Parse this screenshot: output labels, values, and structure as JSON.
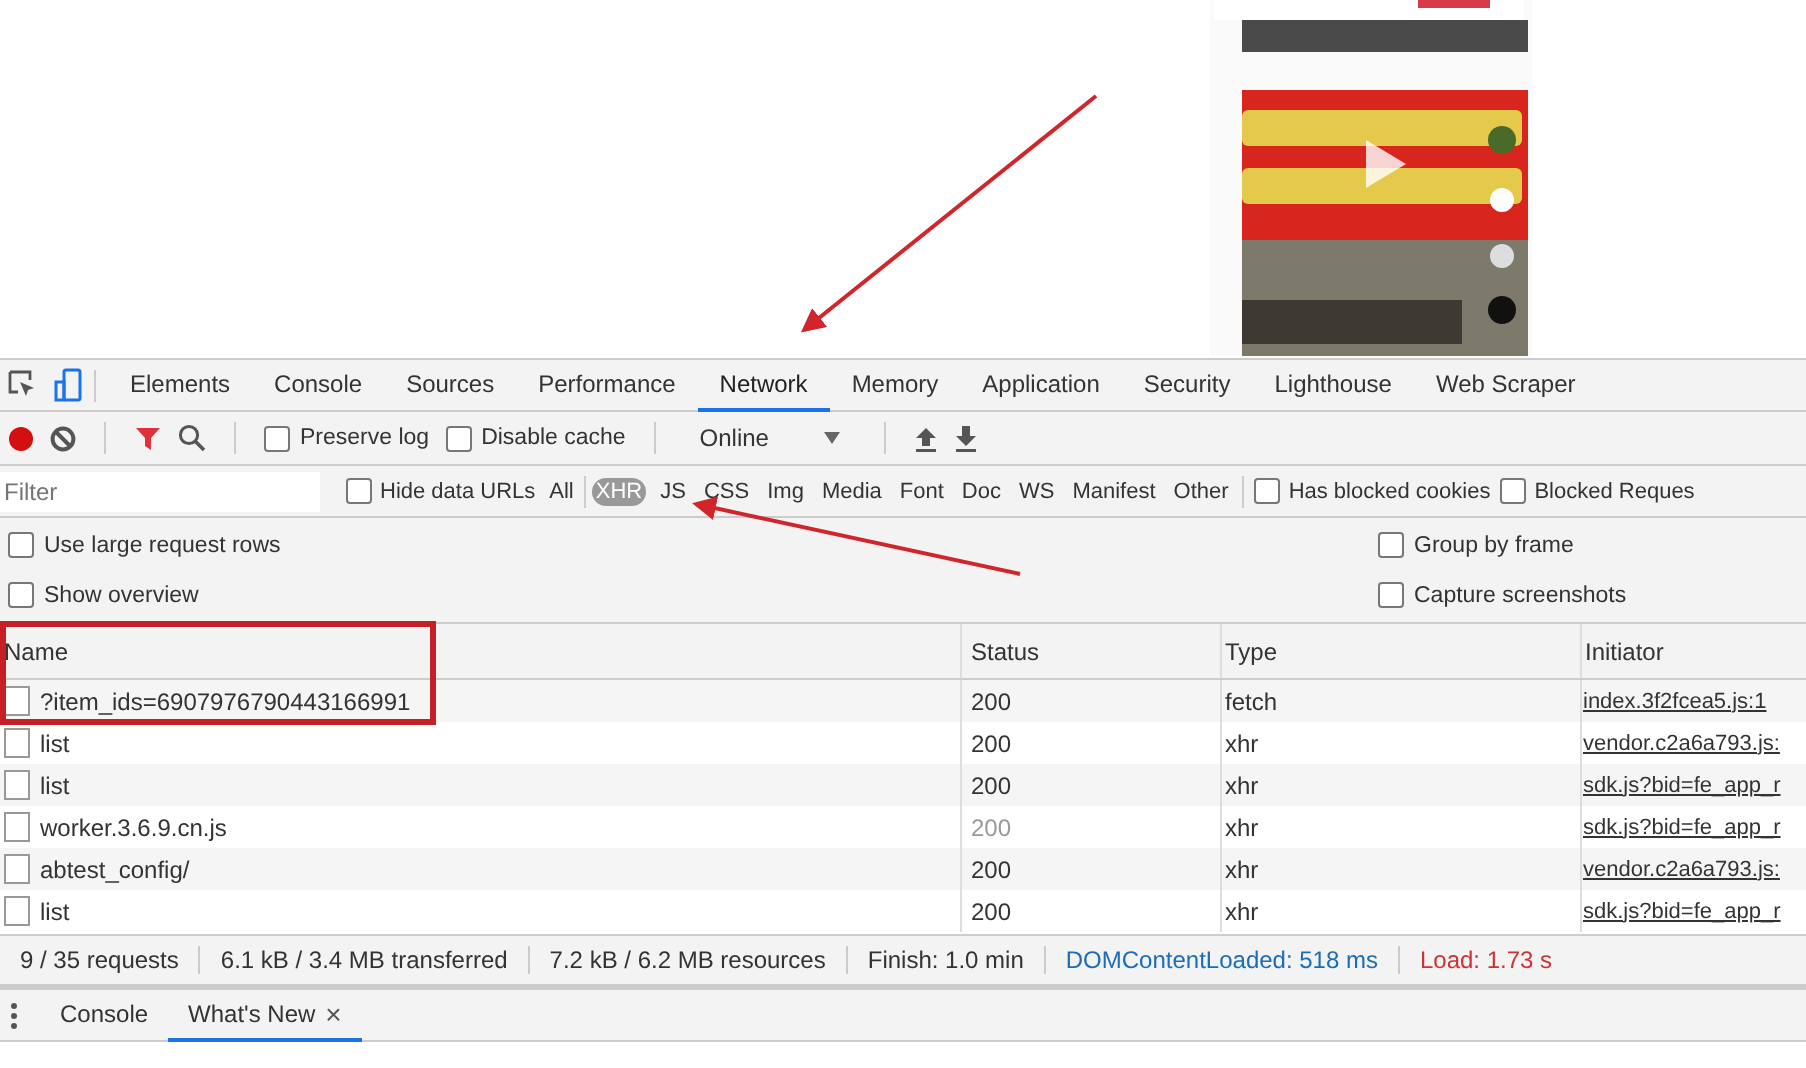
{
  "tabs": [
    {
      "label": "Elements",
      "selected": false
    },
    {
      "label": "Console",
      "selected": false
    },
    {
      "label": "Sources",
      "selected": false
    },
    {
      "label": "Performance",
      "selected": false
    },
    {
      "label": "Network",
      "selected": true
    },
    {
      "label": "Memory",
      "selected": false
    },
    {
      "label": "Application",
      "selected": false
    },
    {
      "label": "Security",
      "selected": false
    },
    {
      "label": "Lighthouse",
      "selected": false
    },
    {
      "label": "Web Scraper",
      "selected": false
    }
  ],
  "toolbar": {
    "recording": true,
    "filter_active": true,
    "preserve_log": {
      "label": "Preserve log",
      "checked": false
    },
    "disable_cache": {
      "label": "Disable cache",
      "checked": false
    },
    "throttling": "Online"
  },
  "filter_bar": {
    "placeholder": "Filter",
    "hide_data_urls": {
      "label": "Hide data URLs",
      "checked": false
    },
    "types": [
      {
        "label": "All",
        "selected": false
      },
      {
        "label": "XHR",
        "selected": true
      },
      {
        "label": "JS",
        "selected": false
      },
      {
        "label": "CSS",
        "selected": false
      },
      {
        "label": "Img",
        "selected": false
      },
      {
        "label": "Media",
        "selected": false
      },
      {
        "label": "Font",
        "selected": false
      },
      {
        "label": "Doc",
        "selected": false
      },
      {
        "label": "WS",
        "selected": false
      },
      {
        "label": "Manifest",
        "selected": false
      },
      {
        "label": "Other",
        "selected": false
      }
    ],
    "has_blocked_cookies": {
      "label": "Has blocked cookies",
      "checked": false
    },
    "blocked_requests": {
      "label": "Blocked Reques",
      "checked": false
    }
  },
  "settings": [
    {
      "label": "Use large request rows",
      "checked": false
    },
    {
      "label": "Group by frame",
      "checked": false
    },
    {
      "label": "Show overview",
      "checked": false
    },
    {
      "label": "Capture screenshots",
      "checked": false
    }
  ],
  "table": {
    "columns": [
      "Name",
      "Status",
      "Type",
      "Initiator"
    ],
    "rows": [
      {
        "name": "?item_ids=6907976790443166991",
        "status": "200",
        "status_dim": false,
        "type": "fetch",
        "initiator": "index.3f2fcea5.js:1"
      },
      {
        "name": "list",
        "status": "200",
        "status_dim": false,
        "type": "xhr",
        "initiator": "vendor.c2a6a793.js:"
      },
      {
        "name": "list",
        "status": "200",
        "status_dim": false,
        "type": "xhr",
        "initiator": "sdk.js?bid=fe_app_r"
      },
      {
        "name": "worker.3.6.9.cn.js",
        "status": "200",
        "status_dim": true,
        "type": "xhr",
        "initiator": "sdk.js?bid=fe_app_r"
      },
      {
        "name": "abtest_config/",
        "status": "200",
        "status_dim": false,
        "type": "xhr",
        "initiator": "vendor.c2a6a793.js:"
      },
      {
        "name": "list",
        "status": "200",
        "status_dim": false,
        "type": "xhr",
        "initiator": "sdk.js?bid=fe_app_r"
      }
    ]
  },
  "summary": [
    {
      "text": "9 / 35 requests",
      "kind": "plain"
    },
    {
      "text": "6.1 kB / 3.4 MB transferred",
      "kind": "plain"
    },
    {
      "text": "7.2 kB / 6.2 MB resources",
      "kind": "plain"
    },
    {
      "text": "Finish: 1.0 min",
      "kind": "plain"
    },
    {
      "text": "DOMContentLoaded: 518 ms",
      "kind": "dom"
    },
    {
      "text": "Load: 1.73 s",
      "kind": "load"
    }
  ],
  "drawer": {
    "tabs": [
      {
        "label": "Console",
        "selected": false,
        "closable": false
      },
      {
        "label": "What's New",
        "selected": true,
        "closable": true
      }
    ],
    "close_glyph": "×"
  }
}
